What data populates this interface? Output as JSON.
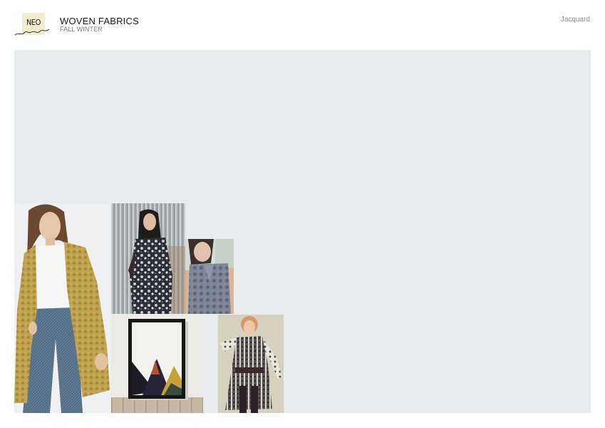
{
  "logo": {
    "text": "NEO"
  },
  "header": {
    "title": "WOVEN FABRICS",
    "subtitle": "FALL WINTER",
    "category": "Jacquard"
  },
  "colors": {
    "board": "#e8ecee",
    "logo_box": "#f3eccf",
    "text_dark": "#1a1a1a",
    "text_muted": "#8b8b8b"
  }
}
